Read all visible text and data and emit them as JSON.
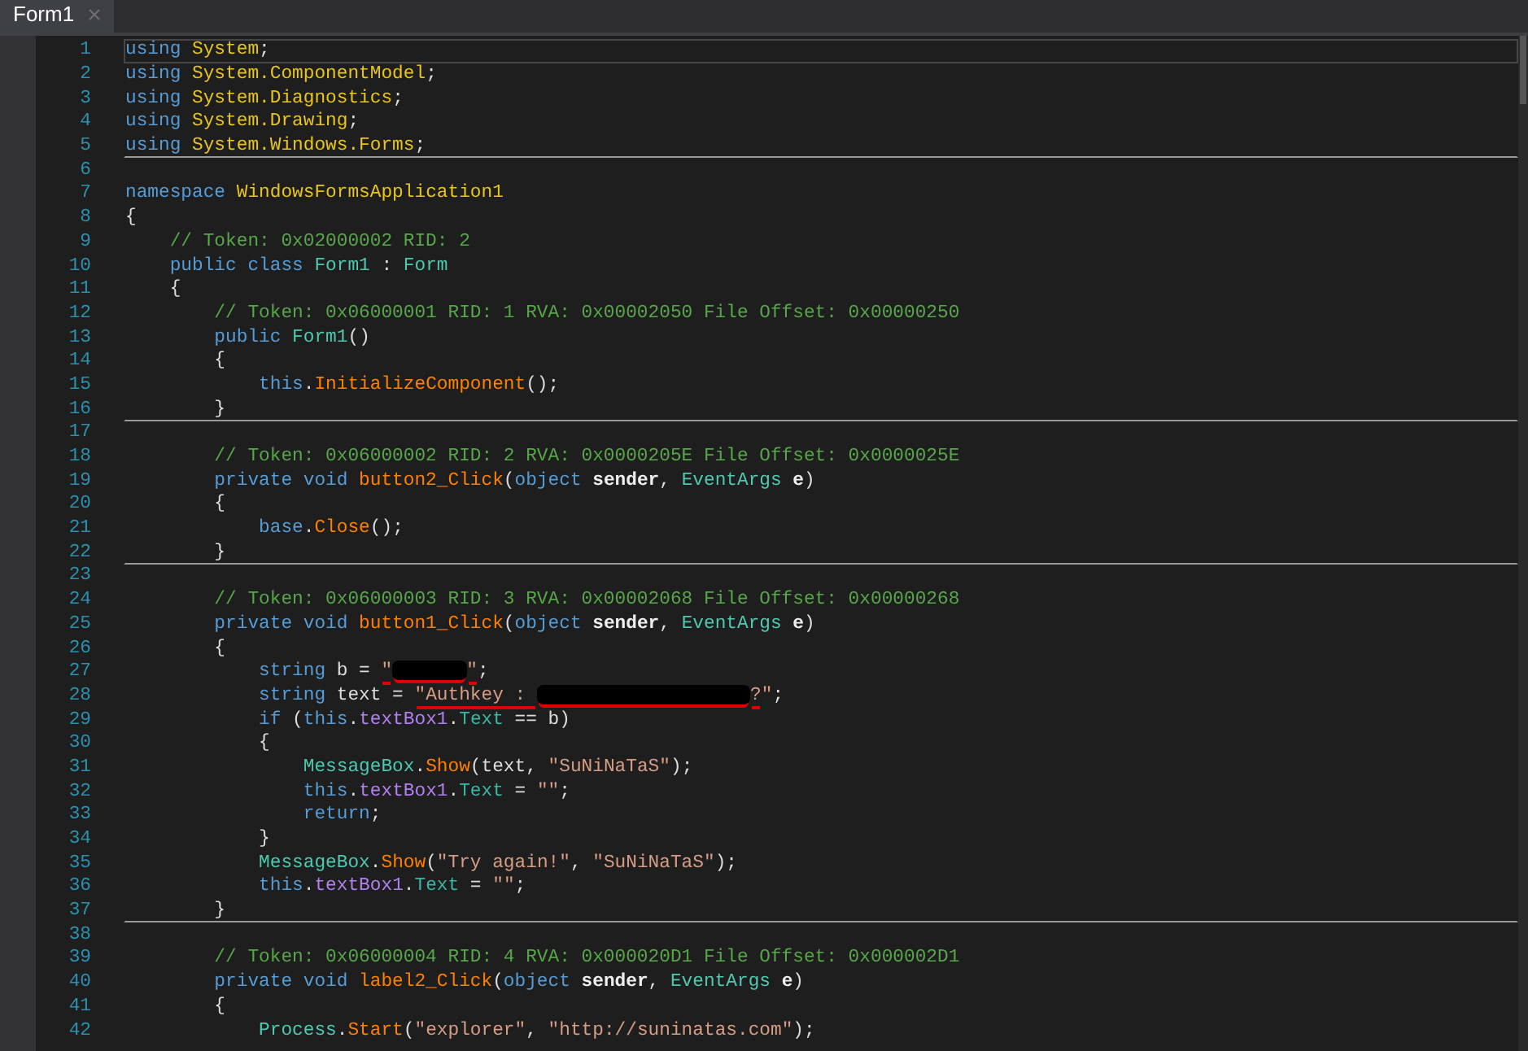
{
  "tab": {
    "title": "Form1",
    "close": "×",
    "selected": true
  },
  "lines": [
    {
      "number": "1",
      "current": true,
      "separator_after": false,
      "tokens": [
        {
          "kind": "kw",
          "text": "using "
        },
        {
          "kind": "ns",
          "text": "System"
        },
        {
          "kind": "plain",
          "text": ";"
        }
      ]
    },
    {
      "number": "2",
      "current": false,
      "separator_after": false,
      "tokens": [
        {
          "kind": "kw",
          "text": "using "
        },
        {
          "kind": "ns",
          "text": "System.ComponentModel"
        },
        {
          "kind": "plain",
          "text": ";"
        }
      ]
    },
    {
      "number": "3",
      "current": false,
      "separator_after": false,
      "tokens": [
        {
          "kind": "kw",
          "text": "using "
        },
        {
          "kind": "ns",
          "text": "System.Diagnostics"
        },
        {
          "kind": "plain",
          "text": ";"
        }
      ]
    },
    {
      "number": "4",
      "current": false,
      "separator_after": false,
      "tokens": [
        {
          "kind": "kw",
          "text": "using "
        },
        {
          "kind": "ns",
          "text": "System.Drawing"
        },
        {
          "kind": "plain",
          "text": ";"
        }
      ]
    },
    {
      "number": "5",
      "current": false,
      "separator_after": true,
      "tokens": [
        {
          "kind": "kw",
          "text": "using "
        },
        {
          "kind": "ns",
          "text": "System.Windows.Forms"
        },
        {
          "kind": "plain",
          "text": ";"
        }
      ]
    },
    {
      "number": "6",
      "current": false,
      "separator_after": false
    },
    {
      "number": "7",
      "current": false,
      "separator_after": false,
      "tokens": [
        {
          "kind": "kw",
          "text": "namespace "
        },
        {
          "kind": "ns",
          "text": "WindowsFormsApplication1"
        }
      ]
    },
    {
      "number": "8",
      "current": false,
      "separator_after": false,
      "tokens": [
        {
          "kind": "plain",
          "text": "{"
        }
      ]
    },
    {
      "number": "9",
      "current": false,
      "separator_after": false,
      "tokens": [
        {
          "kind": "comment",
          "text": "    // Token: 0x02000002 RID: 2"
        }
      ]
    },
    {
      "number": "10",
      "current": false,
      "separator_after": false,
      "tokens": [
        {
          "kind": "kw",
          "text": "    public class "
        },
        {
          "kind": "type",
          "text": "Form1"
        },
        {
          "kind": "plain",
          "text": " : "
        },
        {
          "kind": "type",
          "text": "Form"
        }
      ]
    },
    {
      "number": "11",
      "current": false,
      "separator_after": false,
      "tokens": [
        {
          "kind": "plain",
          "text": "    {"
        }
      ]
    },
    {
      "number": "12",
      "current": false,
      "separator_after": false,
      "tokens": [
        {
          "kind": "comment",
          "text": "        // Token: 0x06000001 RID: 1 RVA: 0x00002050 File Offset: 0x00000250"
        }
      ]
    },
    {
      "number": "13",
      "current": false,
      "separator_after": false,
      "tokens": [
        {
          "kind": "kw",
          "text": "        public "
        },
        {
          "kind": "type",
          "text": "Form1"
        },
        {
          "kind": "plain",
          "text": "()"
        }
      ]
    },
    {
      "number": "14",
      "current": false,
      "separator_after": false,
      "tokens": [
        {
          "kind": "plain",
          "text": "        {"
        }
      ]
    },
    {
      "number": "15",
      "current": false,
      "separator_after": false,
      "tokens": [
        {
          "kind": "kw",
          "text": "            this"
        },
        {
          "kind": "plain",
          "text": "."
        },
        {
          "kind": "method",
          "text": "InitializeComponent"
        },
        {
          "kind": "plain",
          "text": "();"
        }
      ]
    },
    {
      "number": "16",
      "current": false,
      "separator_after": true,
      "tokens": [
        {
          "kind": "plain",
          "text": "        }"
        }
      ]
    },
    {
      "number": "17",
      "current": false,
      "separator_after": false
    },
    {
      "number": "18",
      "current": false,
      "separator_after": false,
      "tokens": [
        {
          "kind": "comment",
          "text": "        // Token: 0x06000002 RID: 2 RVA: 0x0000205E File Offset: 0x0000025E"
        }
      ]
    },
    {
      "number": "19",
      "current": false,
      "separator_after": false,
      "tokens": [
        {
          "kind": "kw",
          "text": "        private void "
        },
        {
          "kind": "method",
          "text": "button2_Click"
        },
        {
          "kind": "plain",
          "text": "("
        },
        {
          "kind": "kw",
          "text": "object "
        },
        {
          "kind": "param",
          "text": "sender"
        },
        {
          "kind": "plain",
          "text": ", "
        },
        {
          "kind": "type",
          "text": "EventArgs "
        },
        {
          "kind": "param",
          "text": "e"
        },
        {
          "kind": "plain",
          "text": ")"
        }
      ]
    },
    {
      "number": "20",
      "current": false,
      "separator_after": false,
      "tokens": [
        {
          "kind": "plain",
          "text": "        {"
        }
      ]
    },
    {
      "number": "21",
      "current": false,
      "separator_after": false,
      "tokens": [
        {
          "kind": "kw",
          "text": "            base"
        },
        {
          "kind": "plain",
          "text": "."
        },
        {
          "kind": "method",
          "text": "Close"
        },
        {
          "kind": "plain",
          "text": "();"
        }
      ]
    },
    {
      "number": "22",
      "current": false,
      "separator_after": true,
      "tokens": [
        {
          "kind": "plain",
          "text": "        }"
        }
      ]
    },
    {
      "number": "23",
      "current": false,
      "separator_after": false
    },
    {
      "number": "24",
      "current": false,
      "separator_after": false,
      "tokens": [
        {
          "kind": "comment",
          "text": "        // Token: 0x06000003 RID: 3 RVA: 0x00002068 File Offset: 0x00000268"
        }
      ]
    },
    {
      "number": "25",
      "current": false,
      "separator_after": false,
      "tokens": [
        {
          "kind": "kw",
          "text": "        private void "
        },
        {
          "kind": "method",
          "text": "button1_Click"
        },
        {
          "kind": "plain",
          "text": "("
        },
        {
          "kind": "kw",
          "text": "object "
        },
        {
          "kind": "param",
          "text": "sender"
        },
        {
          "kind": "plain",
          "text": ", "
        },
        {
          "kind": "type",
          "text": "EventArgs "
        },
        {
          "kind": "param",
          "text": "e"
        },
        {
          "kind": "plain",
          "text": ")"
        }
      ]
    },
    {
      "number": "26",
      "current": false,
      "separator_after": false,
      "tokens": [
        {
          "kind": "plain",
          "text": "        {"
        }
      ]
    },
    {
      "number": "27",
      "current": false,
      "separator_after": false,
      "tokens": [
        {
          "kind": "kw",
          "text": "            string "
        },
        {
          "kind": "plain",
          "text": "b = "
        },
        {
          "kind": "str",
          "text": "\"",
          "underlined": true
        },
        {
          "kind": "redacted_short",
          "underlined": true
        },
        {
          "kind": "str",
          "text": "\"",
          "underlined": true
        },
        {
          "kind": "plain",
          "text": ";"
        }
      ]
    },
    {
      "number": "28",
      "current": false,
      "separator_after": false,
      "tokens": [
        {
          "kind": "kw",
          "text": "            string "
        },
        {
          "kind": "plain",
          "text": "text = "
        },
        {
          "kind": "str",
          "text": "\"Authkey : ",
          "underlined": true
        },
        {
          "kind": "redacted_long",
          "underlined": true
        },
        {
          "kind": "str",
          "text": "?",
          "underlined": true
        },
        {
          "kind": "str",
          "text": "\""
        },
        {
          "kind": "plain",
          "text": ";"
        }
      ]
    },
    {
      "number": "29",
      "current": false,
      "separator_after": false,
      "tokens": [
        {
          "kind": "kw",
          "text": "            if "
        },
        {
          "kind": "plain",
          "text": "("
        },
        {
          "kind": "kw",
          "text": "this"
        },
        {
          "kind": "plain",
          "text": "."
        },
        {
          "kind": "field",
          "text": "textBox1"
        },
        {
          "kind": "plain",
          "text": "."
        },
        {
          "kind": "prop",
          "text": "Text"
        },
        {
          "kind": "plain",
          "text": " == b)"
        }
      ]
    },
    {
      "number": "30",
      "current": false,
      "separator_after": false,
      "tokens": [
        {
          "kind": "plain",
          "text": "            {"
        }
      ]
    },
    {
      "number": "31",
      "current": false,
      "separator_after": false,
      "tokens": [
        {
          "kind": "type",
          "text": "                MessageBox"
        },
        {
          "kind": "plain",
          "text": "."
        },
        {
          "kind": "method",
          "text": "Show"
        },
        {
          "kind": "plain",
          "text": "(text, "
        },
        {
          "kind": "str",
          "text": "\"SuNiNaTaS\""
        },
        {
          "kind": "plain",
          "text": ");"
        }
      ]
    },
    {
      "number": "32",
      "current": false,
      "separator_after": false,
      "tokens": [
        {
          "kind": "kw",
          "text": "                this"
        },
        {
          "kind": "plain",
          "text": "."
        },
        {
          "kind": "field",
          "text": "textBox1"
        },
        {
          "kind": "plain",
          "text": "."
        },
        {
          "kind": "prop",
          "text": "Text"
        },
        {
          "kind": "plain",
          "text": " = "
        },
        {
          "kind": "str",
          "text": "\"\""
        },
        {
          "kind": "plain",
          "text": ";"
        }
      ]
    },
    {
      "number": "33",
      "current": false,
      "separator_after": false,
      "tokens": [
        {
          "kind": "kw",
          "text": "                return"
        },
        {
          "kind": "plain",
          "text": ";"
        }
      ]
    },
    {
      "number": "34",
      "current": false,
      "separator_after": false,
      "tokens": [
        {
          "kind": "plain",
          "text": "            }"
        }
      ]
    },
    {
      "number": "35",
      "current": false,
      "separator_after": false,
      "tokens": [
        {
          "kind": "type",
          "text": "            MessageBox"
        },
        {
          "kind": "plain",
          "text": "."
        },
        {
          "kind": "method",
          "text": "Show"
        },
        {
          "kind": "plain",
          "text": "("
        },
        {
          "kind": "str",
          "text": "\"Try again!\""
        },
        {
          "kind": "plain",
          "text": ", "
        },
        {
          "kind": "str",
          "text": "\"SuNiNaTaS\""
        },
        {
          "kind": "plain",
          "text": ");"
        }
      ]
    },
    {
      "number": "36",
      "current": false,
      "separator_after": false,
      "tokens": [
        {
          "kind": "kw",
          "text": "            this"
        },
        {
          "kind": "plain",
          "text": "."
        },
        {
          "kind": "field",
          "text": "textBox1"
        },
        {
          "kind": "plain",
          "text": "."
        },
        {
          "kind": "prop",
          "text": "Text"
        },
        {
          "kind": "plain",
          "text": " = "
        },
        {
          "kind": "str",
          "text": "\"\""
        },
        {
          "kind": "plain",
          "text": ";"
        }
      ]
    },
    {
      "number": "37",
      "current": false,
      "separator_after": true,
      "tokens": [
        {
          "kind": "plain",
          "text": "        }"
        }
      ]
    },
    {
      "number": "38",
      "current": false,
      "separator_after": false
    },
    {
      "number": "39",
      "current": false,
      "separator_after": false,
      "tokens": [
        {
          "kind": "comment",
          "text": "        // Token: 0x06000004 RID: 4 RVA: 0x000020D1 File Offset: 0x000002D1"
        }
      ]
    },
    {
      "number": "40",
      "current": false,
      "separator_after": false,
      "tokens": [
        {
          "kind": "kw",
          "text": "        private void "
        },
        {
          "kind": "method",
          "text": "label2_Click"
        },
        {
          "kind": "plain",
          "text": "("
        },
        {
          "kind": "kw",
          "text": "object "
        },
        {
          "kind": "param",
          "text": "sender"
        },
        {
          "kind": "plain",
          "text": ", "
        },
        {
          "kind": "type",
          "text": "EventArgs "
        },
        {
          "kind": "param",
          "text": "e"
        },
        {
          "kind": "plain",
          "text": ")"
        }
      ]
    },
    {
      "number": "41",
      "current": false,
      "separator_after": false,
      "tokens": [
        {
          "kind": "plain",
          "text": "        {"
        }
      ]
    },
    {
      "number": "42",
      "current": false,
      "separator_after": false,
      "tokens": [
        {
          "kind": "type",
          "text": "            Process"
        },
        {
          "kind": "plain",
          "text": "."
        },
        {
          "kind": "method",
          "text": "Start"
        },
        {
          "kind": "plain",
          "text": "("
        },
        {
          "kind": "str",
          "text": "\"explorer\""
        },
        {
          "kind": "plain",
          "text": ", "
        },
        {
          "kind": "str",
          "text": "\"http://suninatas.com\""
        },
        {
          "kind": "plain",
          "text": ");"
        }
      ]
    }
  ]
}
